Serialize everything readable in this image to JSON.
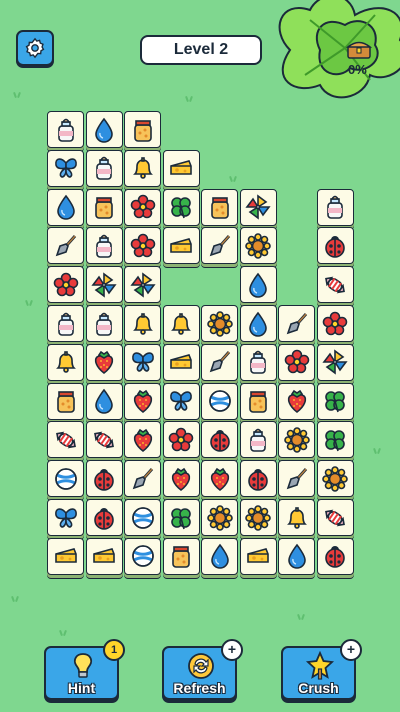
{
  "header": {
    "level_label": "Level 2",
    "progress_text": "0%"
  },
  "board": {
    "tiles": [
      [
        "bottle",
        "drop",
        "jar",
        null,
        null,
        null,
        null,
        null
      ],
      [
        "butterfly",
        "bottle",
        "bell",
        "cheese",
        null,
        null,
        null,
        null
      ],
      [
        "drop",
        "jar",
        "flower",
        "clover",
        "jar",
        "pinwheel",
        null,
        "bottle"
      ],
      [
        "shovel",
        "bottle",
        "flower",
        "cheese",
        "shovel",
        "sunflower",
        null,
        "ladybug"
      ],
      [
        "flower",
        "pinwheel",
        "pinwheel",
        null,
        null,
        "drop",
        null,
        "candy"
      ],
      [
        "bottle",
        "bottle",
        "bell",
        "bell",
        "sunflower",
        "drop",
        "shovel",
        "flower"
      ],
      [
        "bell",
        "strawberry",
        "butterfly",
        "cheese",
        "shovel",
        "bottle",
        "flower",
        "pinwheel"
      ],
      [
        "jar",
        "drop",
        "strawberry",
        "butterfly",
        "ball",
        "jar",
        "strawberry",
        "clover"
      ],
      [
        "candy",
        "candy",
        "strawberry",
        "flower",
        "ladybug",
        "bottle",
        "sunflower",
        "clover"
      ],
      [
        "ball",
        "ladybug",
        "shovel",
        "strawberry",
        "strawberry",
        "ladybug",
        "shovel",
        "sunflower"
      ],
      [
        "butterfly",
        "ladybug",
        "ball",
        "clover",
        "sunflower",
        "sunflower",
        "bell",
        "candy"
      ],
      [
        "cheese",
        "cheese",
        "ball",
        "jar",
        "drop",
        "cheese",
        "drop",
        "ladybug"
      ]
    ]
  },
  "powerups": [
    {
      "label": "Hint",
      "badge": "1",
      "icon": "lightbulb-icon"
    },
    {
      "label": "Refresh",
      "badge": "+",
      "icon": "refresh-icon"
    },
    {
      "label": "Crush",
      "badge": "+",
      "icon": "star-hammer-icon"
    }
  ],
  "colors": {
    "background": "#7fd78f",
    "tile_face": "#fdfbe6",
    "button_blue": "#3aa6e8",
    "outline": "#1b2a3a"
  }
}
